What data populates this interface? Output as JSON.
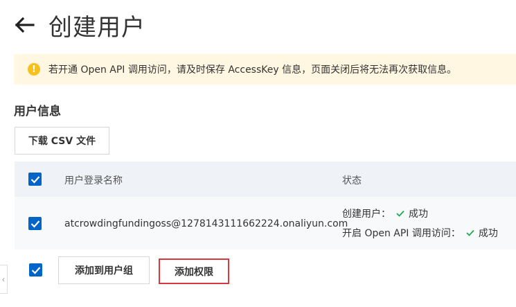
{
  "header": {
    "title": "创建用户"
  },
  "alert": {
    "text": "若开通 Open API 调用访问，请及时保存 AccessKey 信息，页面关闭后将无法再次获取信息。"
  },
  "section": {
    "title": "用户信息"
  },
  "toolbar": {
    "download_csv_label": "下载 CSV 文件"
  },
  "table": {
    "columns": [
      "用户登录名称",
      "状态"
    ],
    "rows": [
      {
        "login_name": "atcrowdingfundingoss@1278143111662224.onaliyun.com",
        "status": [
          {
            "label": "创建用户：",
            "result": "成功"
          },
          {
            "label": "开启 Open API 调用访问：",
            "result": "成功"
          }
        ]
      }
    ]
  },
  "footer": {
    "add_to_group_label": "添加到用户组",
    "add_permission_label": "添加权限"
  },
  "colors": {
    "accent": "#0064c8",
    "success": "#23a74e",
    "warning_bg": "#fff7e1",
    "warning_icon": "#f5c11d",
    "highlight": "#d9363e"
  }
}
